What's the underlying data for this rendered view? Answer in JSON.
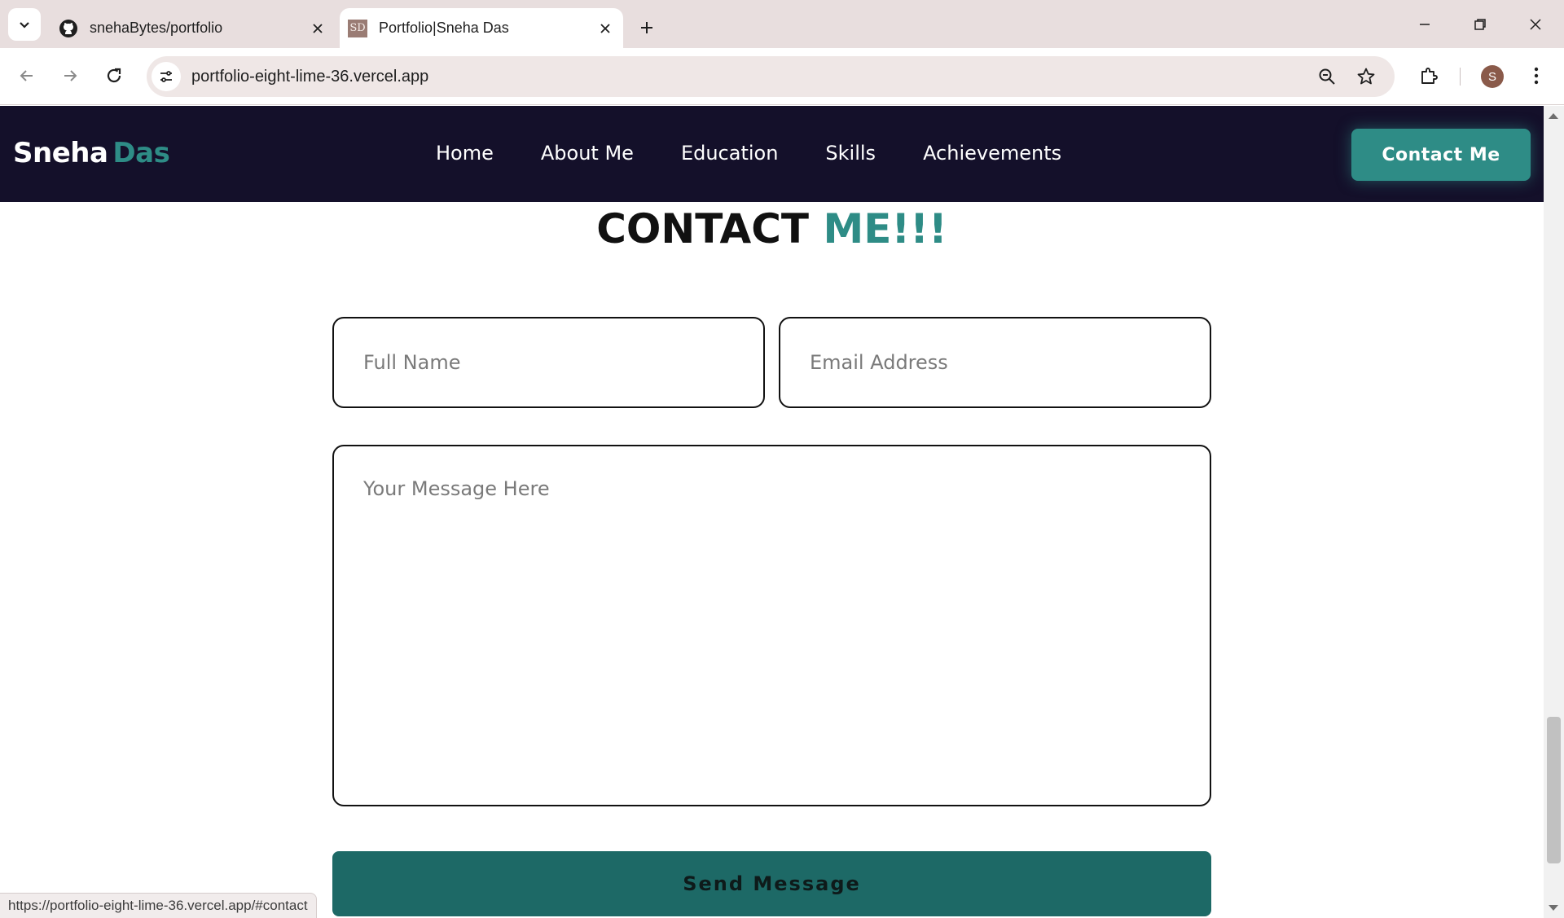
{
  "browser": {
    "tabs": [
      {
        "title": "snehaBytes/portfolio",
        "favicon": "github-icon",
        "active": false
      },
      {
        "title": "Portfolio|Sneha Das",
        "favicon_text": "SD",
        "active": true
      }
    ],
    "url": "portfolio-eight-lime-36.vercel.app",
    "profile_initial": "S",
    "status_url": "https://portfolio-eight-lime-36.vercel.app/#contact"
  },
  "site": {
    "logo_first": "Sneha",
    "logo_second": "Das",
    "nav": [
      "Home",
      "About Me",
      "Education",
      "Skills",
      "Achievements"
    ],
    "cta_label": "Contact Me"
  },
  "contact": {
    "title_part1": "CONTACT",
    "title_part2": "ME!!!",
    "name_placeholder": "Full Name",
    "email_placeholder": "Email Address",
    "message_placeholder": "Your Message Here",
    "submit_label": "Send Message"
  },
  "colors": {
    "accent": "#2e8c86",
    "header_bg": "#14102a",
    "submit_bg": "#1d6966"
  }
}
